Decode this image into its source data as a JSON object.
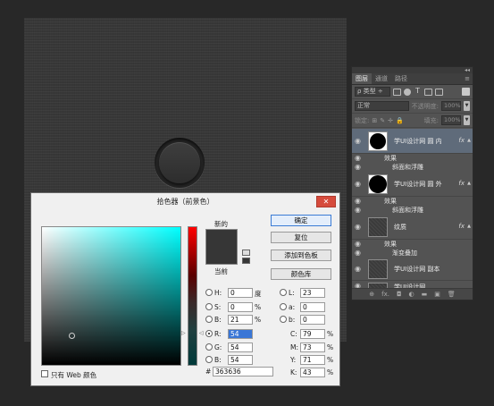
{
  "canvas": {
    "bg": "#383838"
  },
  "layers_panel": {
    "collapse_glyph": "◂◂",
    "tabs": [
      {
        "label": "图层"
      },
      {
        "label": "通道"
      },
      {
        "label": "路径"
      }
    ],
    "menu_glyph": "≡",
    "filter": {
      "label": "ρ 类型 ÷"
    },
    "filter_icons": [
      "image-filter-icon",
      "adjustment-filter-icon",
      "text-filter-icon",
      "shape-filter-icon",
      "smart-object-filter-icon"
    ],
    "blend_mode": "正常",
    "opacity_label": "不透明度:",
    "opacity_value": "100%",
    "lock_label": "锁定:",
    "fill_label": "填充:",
    "fill_value": "100%",
    "layers": [
      {
        "name": "学UI设计网 圆 内",
        "fx": "fx",
        "effects_label": "效果",
        "effect": "斜面和浮雕",
        "selected": true
      },
      {
        "name": "学UI设计网 圆 外",
        "fx": "fx",
        "effects_label": "效果",
        "effect": "斜面和浮雕"
      },
      {
        "name": "纹质",
        "fx": "fx",
        "effects_label": "效果",
        "effect": "渐变叠加"
      },
      {
        "name": "学UI设计网 副本"
      },
      {
        "name": "学UI设计网"
      }
    ],
    "bottom_icons": [
      "⊕",
      "fx.",
      "◘",
      "◐",
      "▬",
      "▣",
      "🗑"
    ]
  },
  "color_picker": {
    "title": "拾色器（前景色）",
    "close": "✕",
    "new_label": "新的",
    "current_label": "当前",
    "new_color": "#363636",
    "buttons": {
      "ok": "确定",
      "reset": "复位",
      "add_swatch": "添加到色板",
      "library": "颜色库"
    },
    "hsb": [
      {
        "label": "H:",
        "value": "0",
        "unit": "度"
      },
      {
        "label": "S:",
        "value": "0",
        "unit": "%"
      },
      {
        "label": "B:",
        "value": "21",
        "unit": "%"
      }
    ],
    "lab": [
      {
        "label": "L:",
        "value": "23"
      },
      {
        "label": "a:",
        "value": "0"
      },
      {
        "label": "b:",
        "value": "0"
      }
    ],
    "rgb": [
      {
        "label": "R:",
        "value": "54"
      },
      {
        "label": "G:",
        "value": "54"
      },
      {
        "label": "B:",
        "value": "54"
      }
    ],
    "cmyk": [
      {
        "label": "C:",
        "value": "79",
        "unit": "%"
      },
      {
        "label": "M:",
        "value": "73",
        "unit": "%"
      },
      {
        "label": "Y:",
        "value": "71",
        "unit": "%"
      },
      {
        "label": "K:",
        "value": "43",
        "unit": "%"
      }
    ],
    "hex_label": "#",
    "hex": "363636",
    "web_only_label": "只有 Web 颜色"
  }
}
